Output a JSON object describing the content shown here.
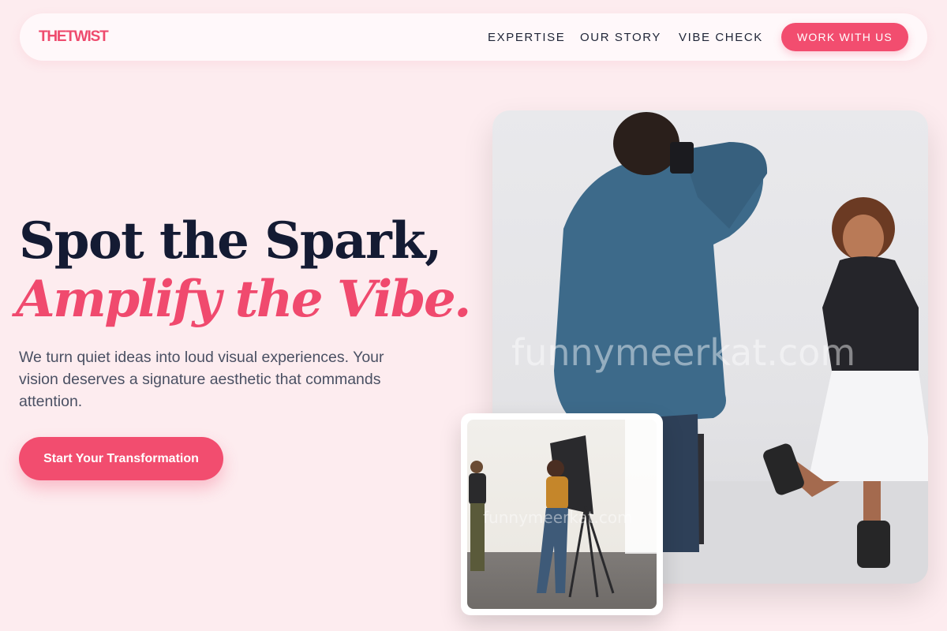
{
  "nav": {
    "logo": "THETWIST",
    "links": [
      "EXPERTISE",
      "OUR STORY",
      "VIBE CHECK"
    ],
    "cta": "WORK WITH US"
  },
  "hero": {
    "headline_line1": "Spot the Spark,",
    "headline_line2": "Amplify the Vibe.",
    "lede": "We turn quiet ideas into loud visual experiences. Your vision deserves a signature aesthetic that commands attention.",
    "cta": "Start Your Transformation"
  },
  "images": {
    "main_watermark": "funnymeerkat.com",
    "thumb_watermark": "funnymeerkat.com"
  },
  "colors": {
    "background": "#fdecef",
    "accent": "#f24d6f",
    "headline_dark": "#141b33"
  }
}
